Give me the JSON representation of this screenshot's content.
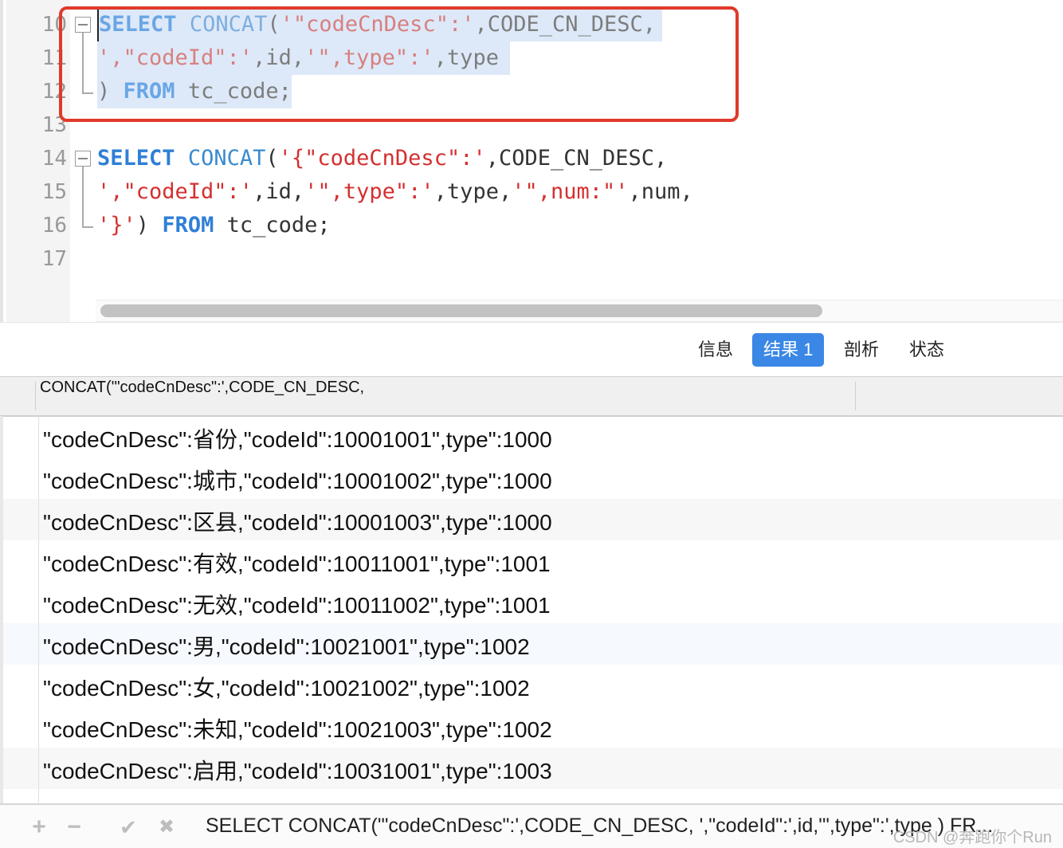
{
  "editor": {
    "line_numbers": [
      "10",
      "11",
      "12",
      "13",
      "14",
      "15",
      "16",
      "17"
    ],
    "query1": {
      "line1": {
        "kw": "SELECT",
        "fn": "CONCAT",
        "paren": "(",
        "str": "'\"codeCnDesc\":'",
        "rest": ",CODE_CN_DESC,"
      },
      "line2": {
        "str1": "',\"codeId\":'",
        "mid1": ",id,",
        "str2": "'\",type\":'",
        "rest": ",type"
      },
      "line3": {
        "paren": ")",
        "kw": "FROM",
        "rest": "tc_code;"
      }
    },
    "query2": {
      "line1": {
        "kw": "SELECT",
        "fn": "CONCAT",
        "paren": "(",
        "str": "'{\"codeCnDesc\":'",
        "rest": ",CODE_CN_DESC,"
      },
      "line2": {
        "str1": "',\"codeId\":'",
        "mid1": ",id,",
        "str2": "'\",type\":'",
        "mid2": ",type,",
        "str3": "'\",num:\"'",
        "rest": ",num,"
      },
      "line3": {
        "str": "'}'",
        "paren": ")",
        "kw": "FROM",
        "rest": "tc_code;"
      }
    }
  },
  "tabs": {
    "info": "信息",
    "result1": "结果 1",
    "profile": "剖析",
    "status": "状态"
  },
  "grid": {
    "column_header": "CONCAT('\"codeCnDesc\":',CODE_CN_DESC,",
    "rows": [
      "\"codeCnDesc\":省份,\"codeId\":10001001\",type\":1000",
      "\"codeCnDesc\":城市,\"codeId\":10001002\",type\":1000",
      "\"codeCnDesc\":区县,\"codeId\":10001003\",type\":1000",
      "\"codeCnDesc\":有效,\"codeId\":10011001\",type\":1001",
      "\"codeCnDesc\":无效,\"codeId\":10011002\",type\":1001",
      "\"codeCnDesc\":男,\"codeId\":10021001\",type\":1002",
      "\"codeCnDesc\":女,\"codeId\":10021002\",type\":1002",
      "\"codeCnDesc\":未知,\"codeId\":10021003\",type\":1002",
      "\"codeCnDesc\":启用,\"codeId\":10031001\",type\":1003"
    ]
  },
  "bottombar": {
    "add_icon": "+",
    "remove_icon": "−",
    "apply_icon": "✔",
    "cancel_icon": "✖",
    "sql": "SELECT CONCAT('\"codeCnDesc\":',CODE_CN_DESC, ',\"codeId\":',id,'\",type\":',type ) FR...",
    "watermark": "CSDN @奔跑你个Run"
  },
  "colors": {
    "accent": "#3a87e6",
    "highlight_box": "#e0392b",
    "keyword": "#2f7fd6",
    "string": "#d43030",
    "selection": "#dde9f8"
  }
}
